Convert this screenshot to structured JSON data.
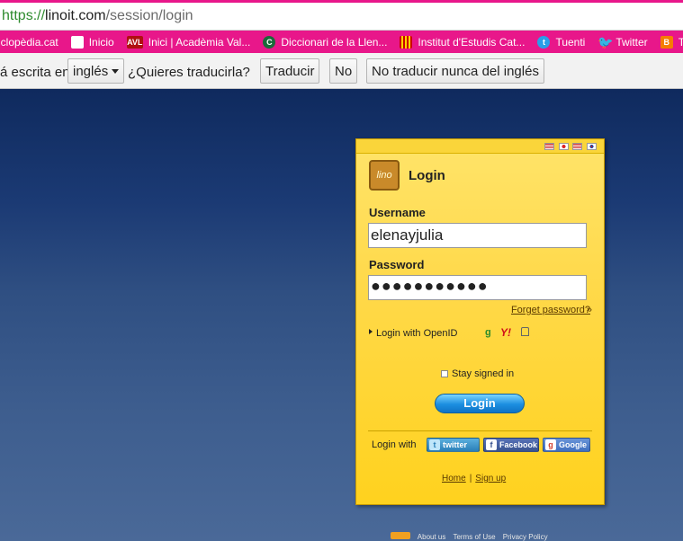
{
  "browser": {
    "url_protocol": "https://",
    "url_host": "linoit.com",
    "url_path": "/session/login"
  },
  "bookmarks": [
    {
      "label": "iclopèdia.cat",
      "icon": "none"
    },
    {
      "label": "Inicio",
      "icon": "document-icon"
    },
    {
      "label": "Inici | Acadèmia Val...",
      "icon": "avl-icon",
      "icon_text": "AVL"
    },
    {
      "label": "Diccionari de la Llen...",
      "icon": "dictionary-icon",
      "icon_text": "C"
    },
    {
      "label": "Institut d'Estudis Cat...",
      "icon": "iec-icon"
    },
    {
      "label": "Tuenti",
      "icon": "tuenti-icon",
      "icon_text": "t"
    },
    {
      "label": "Twitter",
      "icon": "twitter-icon",
      "icon_text": "🐦"
    },
    {
      "label": "TU",
      "icon": "blogger-icon",
      "icon_text": "B"
    }
  ],
  "translate_bar": {
    "prefix": "á escrita en",
    "language": "inglés",
    "question": "¿Quieres traducirla?",
    "translate": "Traducir",
    "no": "No",
    "never": "No traducir nunca del inglés"
  },
  "login": {
    "title": "Login",
    "logo_text": "lino",
    "username_label": "Username",
    "username_value": "elenayjulia",
    "password_label": "Password",
    "password_value": "●●●●●●●●●●●",
    "forgot": "Forget password?",
    "forgot_arrow": "»",
    "openid": "Login with OpenID",
    "openid_google": "g",
    "openid_yahoo": "Y!",
    "stay_signed": "Stay signed in",
    "stay_checked": false,
    "button": "Login",
    "login_with": "Login with",
    "twitter": "twitter",
    "facebook": "Facebook",
    "google": "Google",
    "home": "Home",
    "signup": "Sign up",
    "separator": "|"
  },
  "footer": {
    "about": "About us",
    "terms": "Terms of Use",
    "privacy": "Privacy Policy"
  },
  "colors": {
    "bookmark_bar": "#e8178a",
    "panel": "#ffd21e",
    "login_button": "#1c8ee0"
  }
}
